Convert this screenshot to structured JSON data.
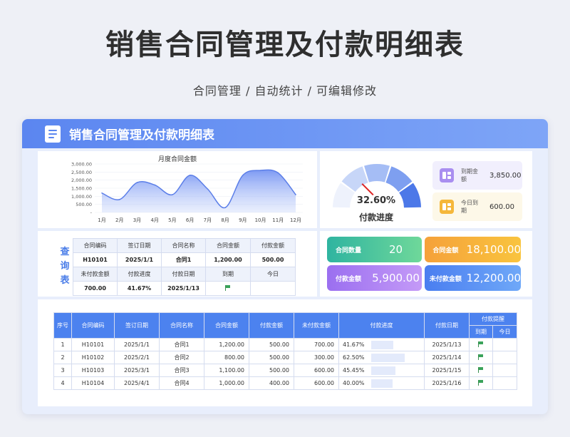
{
  "page": {
    "title": "销售合同管理及付款明细表",
    "subtitle": "合同管理 / 自动统计 / 可编辑修改"
  },
  "panel": {
    "title": "销售合同管理及付款明细表"
  },
  "colors": {
    "accent": "#4c82ef",
    "header_from": "#5b86f0",
    "header_to": "#7ea5f7"
  },
  "chart_data": {
    "type": "area",
    "title": "月度合同金额",
    "categories": [
      "1月",
      "2月",
      "3月",
      "4月",
      "5月",
      "6月",
      "7月",
      "8月",
      "9月",
      "10月",
      "11月",
      "12月"
    ],
    "values": [
      1200,
      800,
      1850,
      1700,
      1100,
      2300,
      1450,
      300,
      2300,
      2600,
      2450,
      1100
    ],
    "ylim": [
      0,
      3000
    ],
    "yticks": [
      "3,000.00",
      "2,500.00",
      "2,000.00",
      "1,500.00",
      "1,000.00",
      "500.00",
      "-"
    ],
    "grid": true
  },
  "gauge": {
    "value_pct": 0.326,
    "value_text": "32.60%",
    "label": "付款进度"
  },
  "mini_cards": [
    {
      "label": "到期金额",
      "value": "3,850.00",
      "icon": "grid-icon"
    },
    {
      "label": "今日到期",
      "value": "600.00",
      "icon": "grid-icon"
    }
  ],
  "query": {
    "side_label": [
      "查",
      "询",
      "表"
    ],
    "row1_headers": [
      "合同编码",
      "签订日期",
      "合同名称",
      "合同金额",
      "付款金额"
    ],
    "row1_values": [
      "H10101",
      "2025/1/1",
      "合同1",
      "1,200.00",
      "500.00"
    ],
    "row2_headers": [
      "未付款金额",
      "付款进度",
      "付款日期",
      "到期",
      "今日"
    ],
    "row2_values": [
      "700.00",
      "41.67%",
      "2025/1/13",
      "",
      ""
    ]
  },
  "stats": [
    {
      "label": "合同数量",
      "value": "20"
    },
    {
      "label": "合同金额",
      "value": "18,100.00"
    },
    {
      "label": "付款金额",
      "value": "5,900.00"
    },
    {
      "label": "未付款金额",
      "value": "12,200.00"
    }
  ],
  "detail": {
    "headers": [
      "序号",
      "合同编码",
      "签订日期",
      "合同名称",
      "合同金额",
      "付款金额",
      "未付款金额",
      "付款进度",
      "付款日期",
      "付款提醒"
    ],
    "sub_headers": [
      "到期",
      "今日"
    ],
    "rows": [
      {
        "no": "1",
        "code": "H10101",
        "date": "2025/1/1",
        "name": "合同1",
        "amount": "1,200.00",
        "paid": "500.00",
        "unpaid": "700.00",
        "progress": "41.67%",
        "progress_val": 0.4167,
        "pay_date": "2025/1/13",
        "due_flag": true
      },
      {
        "no": "2",
        "code": "H10102",
        "date": "2025/2/1",
        "name": "合同2",
        "amount": "800.00",
        "paid": "500.00",
        "unpaid": "300.00",
        "progress": "62.50%",
        "progress_val": 0.625,
        "pay_date": "2025/1/14",
        "due_flag": true
      },
      {
        "no": "3",
        "code": "H10103",
        "date": "2025/3/1",
        "name": "合同3",
        "amount": "1,100.00",
        "paid": "500.00",
        "unpaid": "600.00",
        "progress": "45.45%",
        "progress_val": 0.4545,
        "pay_date": "2025/1/15",
        "due_flag": true
      },
      {
        "no": "4",
        "code": "H10104",
        "date": "2025/4/1",
        "name": "合同4",
        "amount": "1,000.00",
        "paid": "400.00",
        "unpaid": "600.00",
        "progress": "40.00%",
        "progress_val": 0.4,
        "pay_date": "2025/1/16",
        "due_flag": true
      }
    ]
  }
}
